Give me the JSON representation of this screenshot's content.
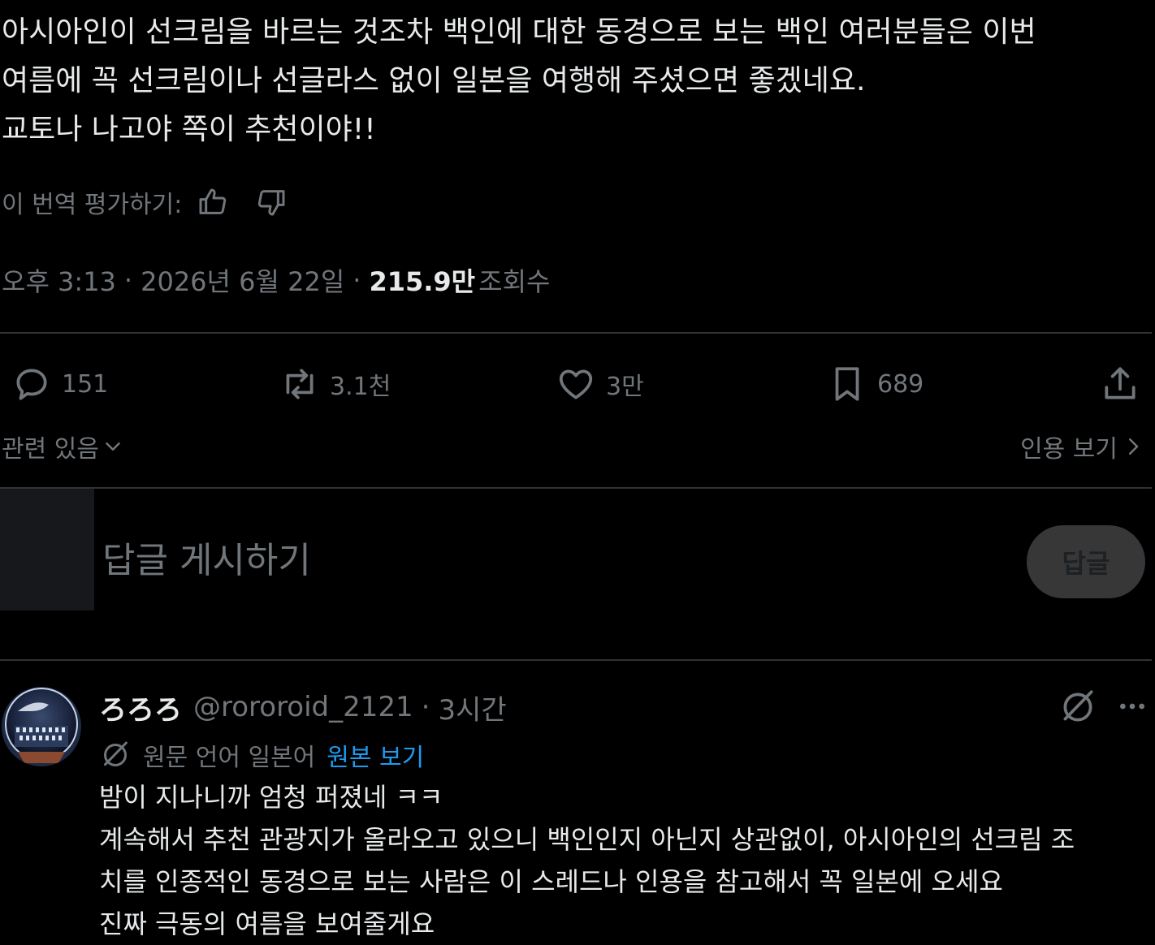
{
  "post": {
    "lines": [
      "아시아인이 선크림을 바르는 것조차 백인에 대한 동경으로 보는 백인 여러분들은 이번",
      "여름에 꼭 선크림이나 선글라스 없이 일본을 여행해 주셨으면 좋겠네요.",
      "교토나 나고야 쪽이 추천이야!!"
    ],
    "rate_translation_label": "이 번역 평가하기:",
    "time": "오후 3:13",
    "date": "2026년 6월 22일",
    "views_count": "215.9만",
    "views_label": "조회수",
    "separator": "·"
  },
  "actions": {
    "replies": "151",
    "reposts": "3.1천",
    "likes": "3만",
    "bookmarks": "689"
  },
  "related_label": "관련 있음",
  "quotes_label": "인용 보기",
  "composer": {
    "placeholder": "답글 게시하기",
    "button_label": "답글"
  },
  "reply": {
    "name": "ろろろ",
    "handle": "@rororoid_2121",
    "separator": "·",
    "time": "3시간",
    "translated_from_label": "원문 언어 일본어",
    "show_original_label": "원본 보기",
    "lines": [
      "밤이 지나니까 엄청 퍼졌네 ㅋㅋ",
      "계속해서 추천 관광지가 올라오고 있으니 백인인지 아닌지 상관없이, 아시아인의 선크림 조",
      "치를 인종적인 동경으로 보는 사람은 이 스레드나 인용을 참고해서 꼭 일본에 오세요",
      "진짜 극동의 여름을 보여줄게요"
    ]
  },
  "colors": {
    "background": "#000000",
    "text": "#e7e9ea",
    "muted": "#71767b",
    "divider": "#2f3336",
    "link": "#1d9bf0"
  }
}
